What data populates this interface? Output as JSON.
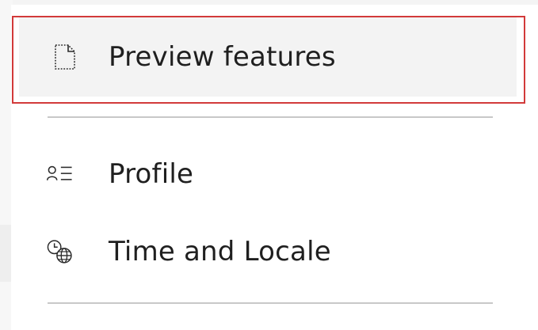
{
  "menu": {
    "items": [
      {
        "label": "Preview features",
        "icon": "preview-features-icon",
        "highlighted": true
      },
      {
        "label": "Profile",
        "icon": "profile-icon"
      },
      {
        "label": "Time and Locale",
        "icon": "time-locale-icon"
      }
    ]
  },
  "colors": {
    "highlight_border": "#d23a3a",
    "hover_background": "#f3f3f3",
    "divider": "#c8c8c8",
    "text": "#1f1f1f"
  }
}
